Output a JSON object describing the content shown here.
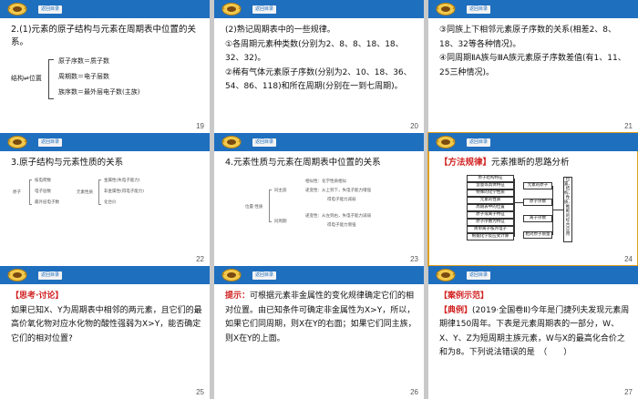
{
  "toolbar": {
    "back_label": "返回目录"
  },
  "slides": [
    {
      "page": "19",
      "heading": "2.(1)元素的原子结构与元素在周期表中位置的关系。",
      "formula": {
        "lhs": "结构⇌位置",
        "rows": [
          "原子序数＝质子数",
          "周期数＝电子层数",
          "族序数＝最外层电子数(主族)"
        ]
      }
    },
    {
      "page": "20",
      "lines": [
        "(2)熟记周期表中的一些规律。",
        "①各周期元素种类数(分别为2、8、8、18、18、32、32)。",
        "②稀有气体元素原子序数(分别为2、10、18、36、54、86、118)和所在周期(分别在一到七周期)。"
      ]
    },
    {
      "page": "21",
      "lines": [
        "③同族上下相邻元素原子序数的关系(相差2、8、18、32等各种情况)。",
        "④同周期ⅡA族与ⅢA族元素原子序数差值(有1、11、25三种情况)。"
      ]
    },
    {
      "page": "22",
      "heading": "3.原子结构与元素性质的关系",
      "diagram": {
        "root": "原子",
        "col1": [
          "核电荷数",
          "电子层数",
          "最外层电子数"
        ],
        "col2": [
          "金属性(失电子能力)",
          "非金属性(得电子能力)",
          "化合价"
        ],
        "mid": "元素性质"
      }
    },
    {
      "page": "23",
      "heading": "4.元素性质与元素在周期表中位置的关系",
      "diagram": {
        "root": "位置·性质",
        "left": [
          "同主族",
          "同周期"
        ],
        "items": [
          "相似性：化学性质相似",
          "递变性：从上到下，失电子能力增强",
          "得电子能力减弱",
          "递变性：从左到右，失电子能力减弱",
          "得电子能力增强"
        ]
      }
    },
    {
      "page": "24",
      "tag": "【方法规律】",
      "title": "元素推断的思路分析",
      "flow": {
        "left": [
          "原子结构特征",
          "含量等具体特征",
          "特殊的化学性质",
          "元素的性质",
          "周期表中的位置",
          "原子或离子特征",
          "原子序数为特征",
          "简单离子核外电子",
          "根据化学反应式计算"
        ],
        "mid": [
          "元素的原子",
          "原子序数",
          "离子序数",
          "相对原子质量"
        ],
        "right": "位置、结构、性质、推断的综合应用"
      }
    },
    {
      "page": "25",
      "tag": "【思考·讨论】",
      "body": "如果已知X、Y为周期表中相邻的两元素，且它们的最高价氧化物对应水化物的酸性强弱为X>Y，能否确定它们的相对位置?"
    },
    {
      "page": "26",
      "tag": "提示：",
      "body": "可根据元素非金属性的变化规律确定它们的相对位置。由已知条件可确定非金属性为X>Y，所以，如果它们同周期，则X在Y的右面；如果它们同主族，则X在Y的上面。"
    },
    {
      "page": "27",
      "tag": "【案例示范】",
      "lead": "【典例】",
      "body": "(2019·全国卷Ⅱ)今年是门捷列夫发现元素周期律150周年。下表是元素周期表的一部分，W、X、Y、Z为短周期主族元素，W与X的最高化合价之和为8。下列说法错误的是　（　　）"
    }
  ]
}
